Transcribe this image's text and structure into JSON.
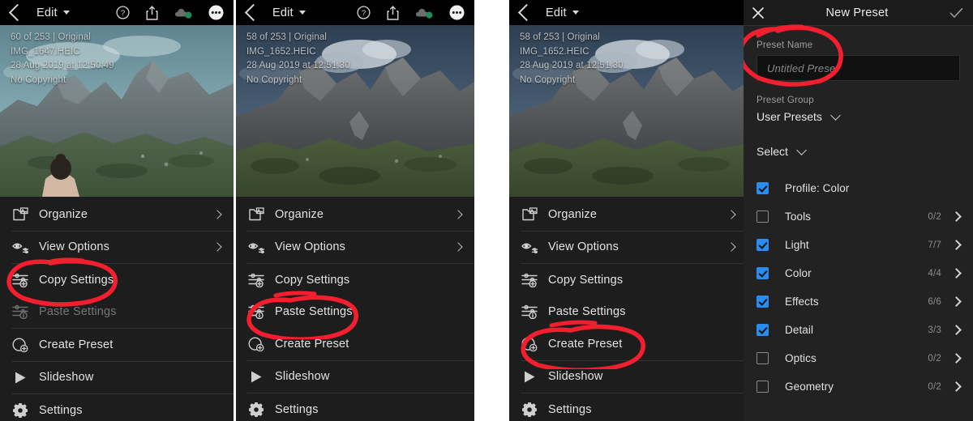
{
  "app": {
    "name": "Lightroom Mobile",
    "accent_blue": "#2a8cf0",
    "annotation_color": "#f41f2e",
    "menu_bg": "#1d1d1d",
    "topbar_bg": "#000000"
  },
  "panels": [
    {
      "id": "panel-1",
      "topbar": {
        "back_icon": "chevron-left-icon",
        "title": "Edit",
        "caret_icon": "caret-down-icon",
        "icons": [
          "help-circle-icon",
          "share-icon",
          "cloud-sync-icon",
          "more-options-icon"
        ]
      },
      "photo_meta": {
        "counter": "60 of 253 | Original",
        "filename": "IMG_1647.HEIC",
        "datetime": "28 Aug 2019 at 12:50:49",
        "copyright": "No Copyright"
      },
      "menu": [
        {
          "label": "Organize",
          "icon": "organize-icon",
          "chevron": true,
          "disabled": false,
          "sep_after": true
        },
        {
          "label": "View Options",
          "icon": "view-options-icon",
          "chevron": true,
          "disabled": false,
          "sep_after": true
        },
        {
          "label": "Copy Settings",
          "icon": "copy-settings-icon",
          "chevron": false,
          "disabled": false,
          "sep_after": false
        },
        {
          "label": "Paste Settings",
          "icon": "paste-settings-icon",
          "chevron": false,
          "disabled": true,
          "sep_after": true
        },
        {
          "label": "Create Preset",
          "icon": "create-preset-icon",
          "chevron": false,
          "disabled": false,
          "sep_after": true
        },
        {
          "label": "Slideshow",
          "icon": "slideshow-icon",
          "chevron": false,
          "disabled": false,
          "sep_after": true
        },
        {
          "label": "Settings",
          "icon": "settings-gear-icon",
          "chevron": false,
          "disabled": false,
          "sep_after": false
        }
      ],
      "annotation": {
        "target": "Copy Settings",
        "shape": "ellipse-with-underline"
      }
    },
    {
      "id": "panel-2",
      "topbar": {
        "back_icon": "chevron-left-icon",
        "title": "Edit",
        "caret_icon": "caret-down-icon",
        "icons": [
          "help-circle-icon",
          "share-icon",
          "cloud-sync-icon",
          "more-options-icon"
        ]
      },
      "photo_meta": {
        "counter": "58 of 253 | Original",
        "filename": "IMG_1652.HEIC",
        "datetime": "28 Aug 2019 at 12:51:30",
        "copyright": "No Copyright"
      },
      "menu": [
        {
          "label": "Organize",
          "icon": "organize-icon",
          "chevron": true,
          "disabled": false,
          "sep_after": true
        },
        {
          "label": "View Options",
          "icon": "view-options-icon",
          "chevron": true,
          "disabled": false,
          "sep_after": true
        },
        {
          "label": "Copy Settings",
          "icon": "copy-settings-icon",
          "chevron": false,
          "disabled": false,
          "sep_after": false
        },
        {
          "label": "Paste Settings",
          "icon": "paste-settings-icon",
          "chevron": false,
          "disabled": false,
          "sep_after": false
        },
        {
          "label": "Create Preset",
          "icon": "create-preset-icon",
          "chevron": false,
          "disabled": false,
          "sep_after": true
        },
        {
          "label": "Slideshow",
          "icon": "slideshow-icon",
          "chevron": false,
          "disabled": false,
          "sep_after": true
        },
        {
          "label": "Settings",
          "icon": "settings-gear-icon",
          "chevron": false,
          "disabled": false,
          "sep_after": false
        }
      ],
      "annotation": {
        "target": "Paste Settings",
        "shape": "ellipse-with-underline"
      }
    },
    {
      "id": "panel-3",
      "topbar": {
        "back_icon": "chevron-left-icon",
        "title": "Edit",
        "caret_icon": "caret-down-icon",
        "icons": [
          "help-circle-icon",
          "share-icon",
          "cloud-sync-icon",
          "more-options-icon"
        ]
      },
      "photo_meta": {
        "counter": "58 of 253 | Original",
        "filename": "IMG_1652.HEIC",
        "datetime": "28 Aug 2019 at 12:51:30",
        "copyright": "No Copyright"
      },
      "menu": [
        {
          "label": "Organize",
          "icon": "organize-icon",
          "chevron": true,
          "disabled": false,
          "sep_after": true
        },
        {
          "label": "View Options",
          "icon": "view-options-icon",
          "chevron": true,
          "disabled": false,
          "sep_after": true
        },
        {
          "label": "Copy Settings",
          "icon": "copy-settings-icon",
          "chevron": false,
          "disabled": false,
          "sep_after": false
        },
        {
          "label": "Paste Settings",
          "icon": "paste-settings-icon",
          "chevron": false,
          "disabled": false,
          "sep_after": false
        },
        {
          "label": "Create Preset",
          "icon": "create-preset-icon",
          "chevron": false,
          "disabled": false,
          "sep_after": true
        },
        {
          "label": "Slideshow",
          "icon": "slideshow-icon",
          "chevron": false,
          "disabled": false,
          "sep_after": true
        },
        {
          "label": "Settings",
          "icon": "settings-gear-icon",
          "chevron": false,
          "disabled": false,
          "sep_after": false
        }
      ],
      "annotation": {
        "target": "Create Preset",
        "shape": "ellipse-with-underline"
      }
    }
  ],
  "preset_dialog": {
    "close_icon": "close-x-icon",
    "title": "New Preset",
    "confirm_icon": "check-icon",
    "name_field": {
      "label": "Preset Name",
      "value": "",
      "placeholder": "Untitled Preset"
    },
    "group_field": {
      "label": "Preset Group",
      "value": "User Presets",
      "chevron_icon": "chevron-down-icon"
    },
    "select_field": {
      "value": "Select",
      "chevron_icon": "chevron-down-icon"
    },
    "options": [
      {
        "label": "Profile: Color",
        "checked": true,
        "count": "",
        "chevron": false
      },
      {
        "label": "Tools",
        "checked": false,
        "count": "0/2",
        "chevron": true
      },
      {
        "label": "Light",
        "checked": true,
        "count": "7/7",
        "chevron": true
      },
      {
        "label": "Color",
        "checked": true,
        "count": "4/4",
        "chevron": true
      },
      {
        "label": "Effects",
        "checked": true,
        "count": "6/6",
        "chevron": true
      },
      {
        "label": "Detail",
        "checked": true,
        "count": "3/3",
        "chevron": true
      },
      {
        "label": "Optics",
        "checked": false,
        "count": "0/2",
        "chevron": true
      },
      {
        "label": "Geometry",
        "checked": false,
        "count": "0/2",
        "chevron": true
      }
    ],
    "annotation": {
      "target": "Preset Name",
      "shape": "ellipse"
    }
  }
}
